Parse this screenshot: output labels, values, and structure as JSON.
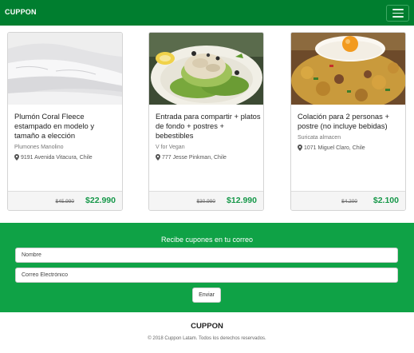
{
  "navbar": {
    "brand": "CUPPON",
    "menu_icon": "hamburger-menu-icon",
    "color": "#007e2f"
  },
  "deals": [
    {
      "image": "folded-white-blanket",
      "title": "Plumón Coral Fleece estampado en modelo y tamaño a elección",
      "vendor": "Plumones Manolino",
      "address": "9191 Avenida Vitacura, Chile",
      "old_price": "$45.990",
      "price": "$22.990"
    },
    {
      "image": "stuffed-avocado-plate",
      "title": "Entrada para compartir + platos de fondo + postres + bebestibles",
      "vendor": "V for Vegan",
      "address": "777 Jesse Pinkman, Chile",
      "old_price": "$30.990",
      "price": "$12.990"
    },
    {
      "image": "fried-egg-over-potatoes",
      "title": "Colación para 2 personas + postre (no incluye bebidas)",
      "vendor": "Suricata almacen",
      "address": "1071 Miguel Claro, Chile",
      "old_price": "$4.200",
      "price": "$2.100"
    }
  ],
  "newsletter": {
    "title": "Recibe cupones en tu correo",
    "name_placeholder": "Nombre",
    "email_placeholder": "Correo Electrónico",
    "submit_label": "Enviar",
    "color": "#0fa246"
  },
  "footer": {
    "brand": "CUPPON",
    "copyright": "© 2018 Cuppon Latam. Todos los derechos reservados."
  },
  "colors": {
    "price": "#17984a"
  }
}
